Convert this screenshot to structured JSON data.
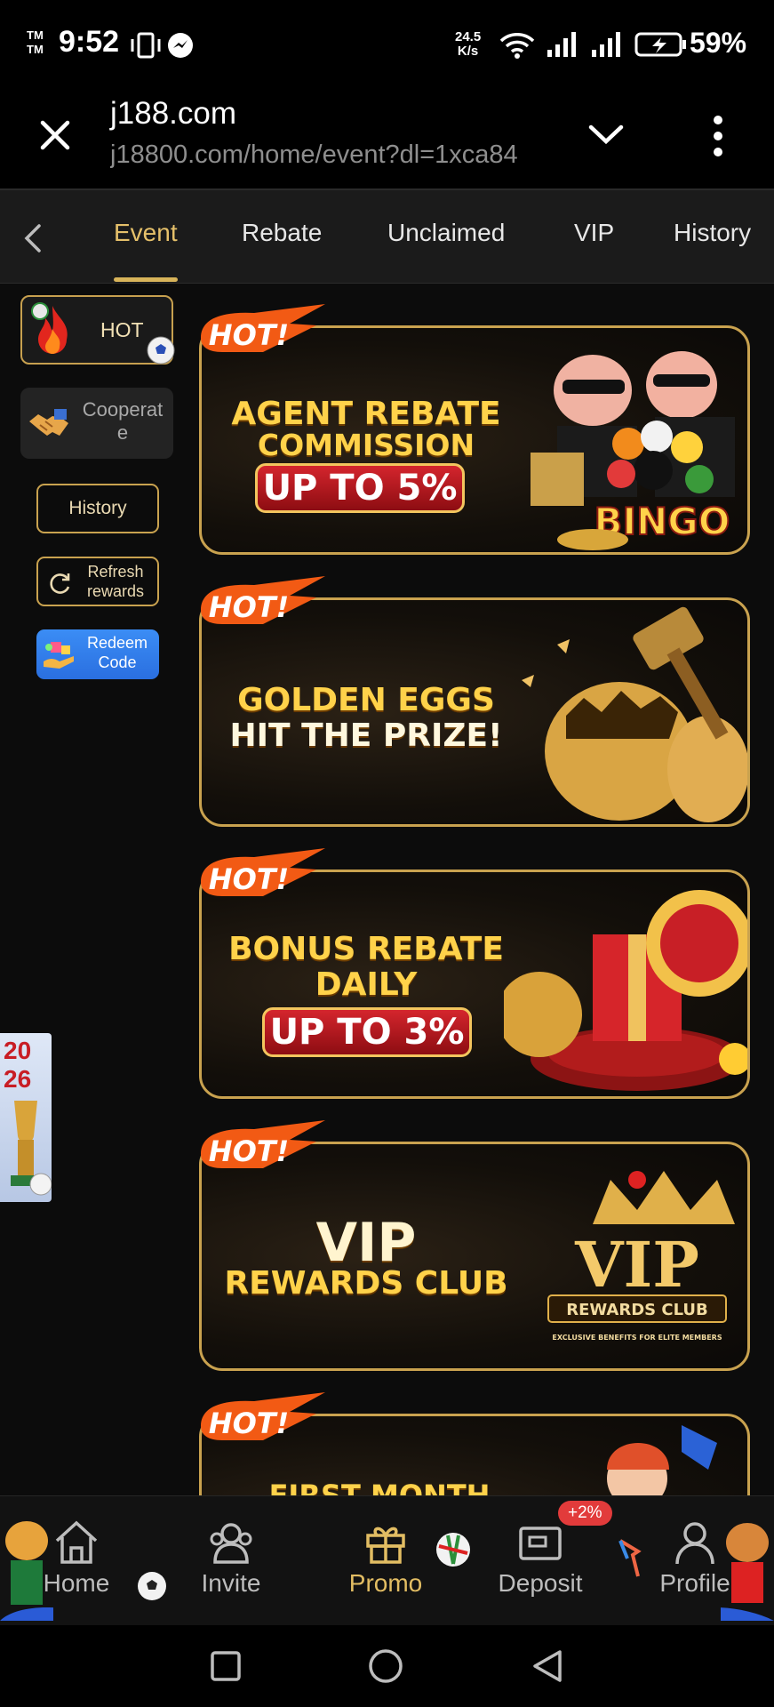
{
  "status_bar": {
    "tm": "TM\nTM",
    "time": "9:52",
    "speed": "24.5\nK/s",
    "battery": "59%"
  },
  "browser": {
    "domain": "j188.com",
    "url": "j18800.com/home/event?dl=1xca84"
  },
  "tabs": [
    {
      "label": "Event",
      "active": true
    },
    {
      "label": "Rebate"
    },
    {
      "label": "Unclaimed"
    },
    {
      "label": "VIP"
    },
    {
      "label": "History"
    }
  ],
  "side_menu": {
    "hot": "HOT",
    "cooperate": "Cooperat e",
    "history": "History",
    "refresh": "Refresh rewards",
    "redeem": "Redeem Code"
  },
  "banners": [
    {
      "tag": "HOT!",
      "line1": "AGENT REBATE",
      "line2": "COMMISSION",
      "pill": "UP TO 5%",
      "art_text": "BINGO"
    },
    {
      "tag": "HOT!",
      "line1": "GOLDEN EGGS",
      "line2": "HIT THE PRIZE!"
    },
    {
      "tag": "HOT!",
      "line1": "BONUS REBATE",
      "line2": "DAILY",
      "pill": "UP TO 3%"
    },
    {
      "tag": "HOT!",
      "line1": "VIP",
      "line2": "REWARDS CLUB",
      "art_title": "VIP",
      "art_sub": "REWARDS CLUB",
      "art_note": "EXCLUSIVE BENEFITS FOR ELITE MEMBERS"
    },
    {
      "tag": "HOT!",
      "line1": "FIRST MONTH BONUSES"
    }
  ],
  "floating": {
    "year": "20\n26"
  },
  "bottom_nav": {
    "items": [
      {
        "label": "Home"
      },
      {
        "label": "Invite"
      },
      {
        "label": "Promo",
        "active": true
      },
      {
        "label": "Deposit"
      },
      {
        "label": "Profile"
      }
    ],
    "deposit_badge": "+2%"
  },
  "colors": {
    "gold": "#e5c06a",
    "background": "#0c0c0c",
    "accent_red": "#d4252d"
  }
}
